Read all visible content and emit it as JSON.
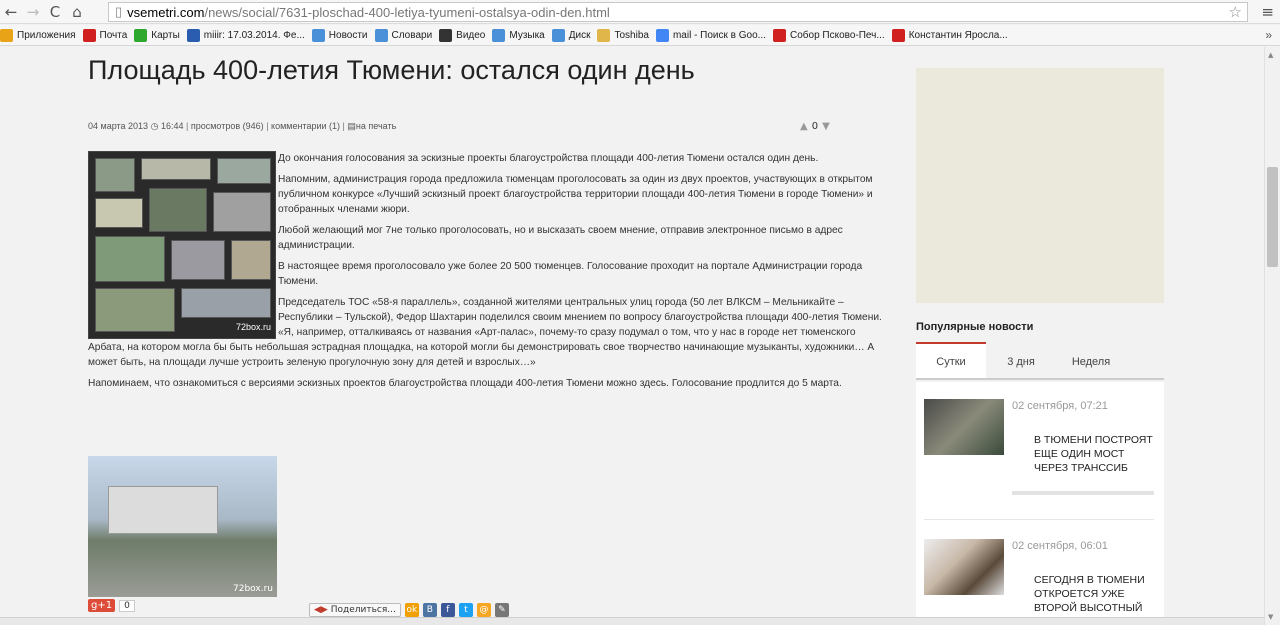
{
  "browser": {
    "url_domain": "vsemetri.com",
    "url_path": "/news/social/7631-ploschad-400-letiya-tyumeni-ostalsya-odin-den.html",
    "bookmarks": [
      {
        "label": "Приложения",
        "icon": "apps-icon",
        "color": "#e8a317"
      },
      {
        "label": "Почта",
        "icon": "yandex-mail-icon",
        "color": "#d02020"
      },
      {
        "label": "Карты",
        "icon": "maps-icon",
        "color": "#2ea82e"
      },
      {
        "label": "miiir: 17.03.2014. Фе...",
        "icon": "user-icon",
        "color": "#2a5db0"
      },
      {
        "label": "Новости",
        "icon": "news-icon",
        "color": "#4a90d9"
      },
      {
        "label": "Словари",
        "icon": "dictionary-icon",
        "color": "#4a90d9"
      },
      {
        "label": "Видео",
        "icon": "video-icon",
        "color": "#333333"
      },
      {
        "label": "Музыка",
        "icon": "music-icon",
        "color": "#4a90d9"
      },
      {
        "label": "Диск",
        "icon": "disk-icon",
        "color": "#4a90d9"
      },
      {
        "label": "Toshiba",
        "icon": "folder-icon",
        "color": "#e0b64a"
      },
      {
        "label": "mail - Поиск в Goo...",
        "icon": "google-icon",
        "color": "#4285f4"
      },
      {
        "label": "Собор Псково-Печ...",
        "icon": "yandex-icon",
        "color": "#d02020"
      },
      {
        "label": "Константин Яросла...",
        "icon": "yandex-icon",
        "color": "#d02020"
      }
    ]
  },
  "article": {
    "title": "Площадь 400-летия Тюмени: остался один день",
    "date": "04 марта 2013",
    "time": "16:44",
    "views": "просмотров (946)",
    "comments": "комментарии (1)",
    "print": "на печать",
    "rating": "0",
    "paragraphs": [
      "До окончания голосования за эскизные проекты благоустройства площади 400-летия Тюмени остался один день.",
      "Напомним, администрация города предложила тюменцам проголосовать за один из двух проектов, участвующих в открытом публичном конкурсе «Лучший эскизный проект благоустройства территории площади 400-летия Тюмени в городе Тюмени» и отобранных членами жюри.",
      "Любой желающий мог 7не только проголосовать, но и высказать своем мнение, отправив электронное письмо в адрес администрации.",
      "В настоящее время проголосовало уже более 20 500 тюменцев. Голосование проходит на портале Администрации города Тюмени.",
      "Председатель ТОС «58-я параллель», созданной жителями центральных улиц города (50 лет ВЛКСМ – Мельникайте – Республики – Тульской), Федор Шахтарин поделился своим мнением по вопросу благоустройства площади 400-летия Тюмени. «Я, например, отталкиваясь от названия «Арт-палас», почему-то сразу подумал о том, что у нас в городе нет тюменского Арбата, на котором могла бы быть небольшая эстрадная площадка, на которой могли бы демонстрировать свое творчество начинающие музыканты, художники… А может быть, на площади лучше устроить зеленую прогулочную зону для детей и взрослых…»",
      "Напоминаем, что ознакомиться с версиями эскизных проектов благоустройства площади 400-летия Тюмени можно здесь. Голосование продлится до 5 марта."
    ],
    "watermark": "72box.ru",
    "gplus_label": "g+1",
    "gplus_count": "0",
    "share_label": "Поделиться..."
  },
  "sidebar": {
    "popular_title": "Популярные новости",
    "tabs": [
      "Сутки",
      "3 дня",
      "Неделя"
    ],
    "news": [
      {
        "date": "02 сентября, 07:21",
        "title": "В Тюмени построят еще один мост через Транссиб"
      },
      {
        "date": "02 сентября, 06:01",
        "title": "Сегодня в Тюмени откроется уже второй высотный"
      }
    ]
  }
}
